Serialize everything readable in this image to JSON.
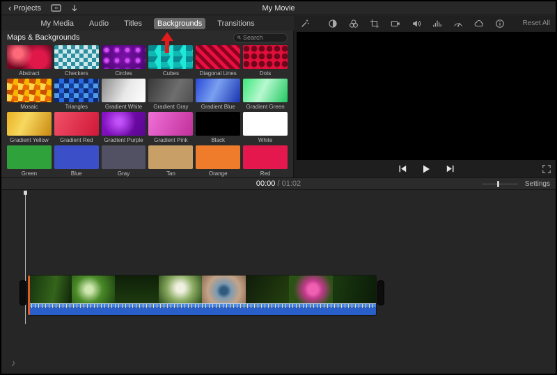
{
  "titlebar": {
    "back_label": "Projects",
    "title": "My Movie"
  },
  "tabs": [
    {
      "label": "My Media",
      "active": false
    },
    {
      "label": "Audio",
      "active": false
    },
    {
      "label": "Titles",
      "active": false
    },
    {
      "label": "Backgrounds",
      "active": true
    },
    {
      "label": "Transitions",
      "active": false
    }
  ],
  "annotation": {
    "arrow_color": "#e41b1b",
    "points_to": "Backgrounds"
  },
  "browser": {
    "header": "Maps & Backgrounds",
    "search_placeholder": "Search",
    "items": [
      {
        "name": "Abstract",
        "bg": "radial-gradient(circle at 25% 35%, #ff6a7a 0 12%, transparent 40%), radial-gradient(circle at 70% 60%, #e0184a 0 25%, transparent 60%), linear-gradient(120deg, #8a0828, #3a0210)"
      },
      {
        "name": "Checkers",
        "bg": "repeating-conic-gradient(#cde9ec 0 25%, #2d8fa0 0 50%) 0 0/12px 12px"
      },
      {
        "name": "Circles",
        "bg": "radial-gradient(circle at 7px 7px, #d050f0 3px, #8a18b8 3.5px 5px, transparent 5.5px) 0 0/15px 15px, radial-gradient(circle at 50% 50%, #7a10a8, #4a0870)"
      },
      {
        "name": "Cubes",
        "bg": "repeating-conic-gradient(from 30deg, #1fe8d8 0 120deg, #0fb8b0 0 240deg, #0a8890 0 360deg) 0 0/18px 16px"
      },
      {
        "name": "Diagonal Lines",
        "bg": "repeating-linear-gradient(45deg, #e81040 0 5px, #8a0020 5px 10px)"
      },
      {
        "name": "Dots",
        "bg": "radial-gradient(circle at 5px 5px, #70041a 4px, transparent 4.6px) 0 0/11px 11px, #e0103c"
      },
      {
        "name": "Mosaic",
        "bg": "repeating-conic-gradient(from 15deg, #f7b500 0 25%, #e86a00 0 50%, #ffd54a 0 75%, #c94f00 0 100%) 0 0/16px 16px"
      },
      {
        "name": "Triangles",
        "bg": "repeating-conic-gradient(from 0deg, #2a6ae0 0 25%, #123f9e 0 50%, #4f9be8 0 75%, #0c2a70 0 100%) 0 0/14px 14px"
      },
      {
        "name": "Gradient White",
        "bg": "linear-gradient(115deg, #8a8a8a, #e8e8e8 55%, #ffffff)"
      },
      {
        "name": "Gradient Gray",
        "bg": "linear-gradient(115deg, #383838, #6e6e6e 60%, #505050)"
      },
      {
        "name": "Gradient Blue",
        "bg": "linear-gradient(115deg, #2a4ad8, #7aa0f0 45%, #1a34b0)"
      },
      {
        "name": "Gradient Green",
        "bg": "linear-gradient(115deg, #3ae87a, #b8f8d0 45%, #20c860)"
      },
      {
        "name": "Gradient Yellow",
        "bg": "linear-gradient(115deg, #e8b020, #f8d860 40%, #c88810)"
      },
      {
        "name": "Gradient Red",
        "bg": "linear-gradient(115deg, #f05068, #d01838)"
      },
      {
        "name": "Gradient Purple",
        "bg": "radial-gradient(circle at 40% 40%, #c050f8 0 10%, transparent 55%), linear-gradient(115deg, #8a10c8, #5a0690)"
      },
      {
        "name": "Gradient Pink",
        "bg": "linear-gradient(115deg, #f070d8, #c0309a)"
      },
      {
        "name": "Black",
        "bg": "#000000"
      },
      {
        "name": "White",
        "bg": "#ffffff"
      },
      {
        "name": "Green",
        "bg": "#2fa23c"
      },
      {
        "name": "Blue",
        "bg": "#3b50c8"
      },
      {
        "name": "Gray",
        "bg": "#515163"
      },
      {
        "name": "Tan",
        "bg": "#c89f66"
      },
      {
        "name": "Orange",
        "bg": "#ee7c2b"
      },
      {
        "name": "Red",
        "bg": "#e5184d"
      }
    ]
  },
  "preview": {
    "tools": [
      "magic-wand",
      "color-balance",
      "color-correction",
      "crop",
      "stabilization",
      "volume",
      "noise-reduction",
      "speed",
      "effects",
      "info"
    ],
    "reset_label": "Reset All"
  },
  "transport": {
    "controls": [
      "skip-back",
      "play",
      "skip-forward"
    ]
  },
  "timeline": {
    "current_time": "00:00",
    "separator": " / ",
    "duration": "01:02",
    "settings_label": "Settings",
    "clip_segments": [
      "linear-gradient(100deg,#14320c,#35641c 60%,#0e2408)",
      "radial-gradient(circle at 40% 50%, #cfe8b0 12%, #4a8a28 45%, #1e4410)",
      "linear-gradient(180deg,#0e2008,#1d3a10)",
      "radial-gradient(circle at 50% 45%, #f0f0e0 16%, #88aa60 50%, #2a4a18)",
      "radial-gradient(circle at 50% 55%, #2e5a7e 13%, #7e9ab0 28%, #c4a488 60%, #8a6a50)",
      "linear-gradient(120deg,#101c0a,#24400f)",
      "radial-gradient(circle at 55% 50%, #f060b0 18%, #c03a8a 33%, #2c5216 70%)",
      "linear-gradient(100deg,#1a3a10,#0c1c08)"
    ]
  }
}
